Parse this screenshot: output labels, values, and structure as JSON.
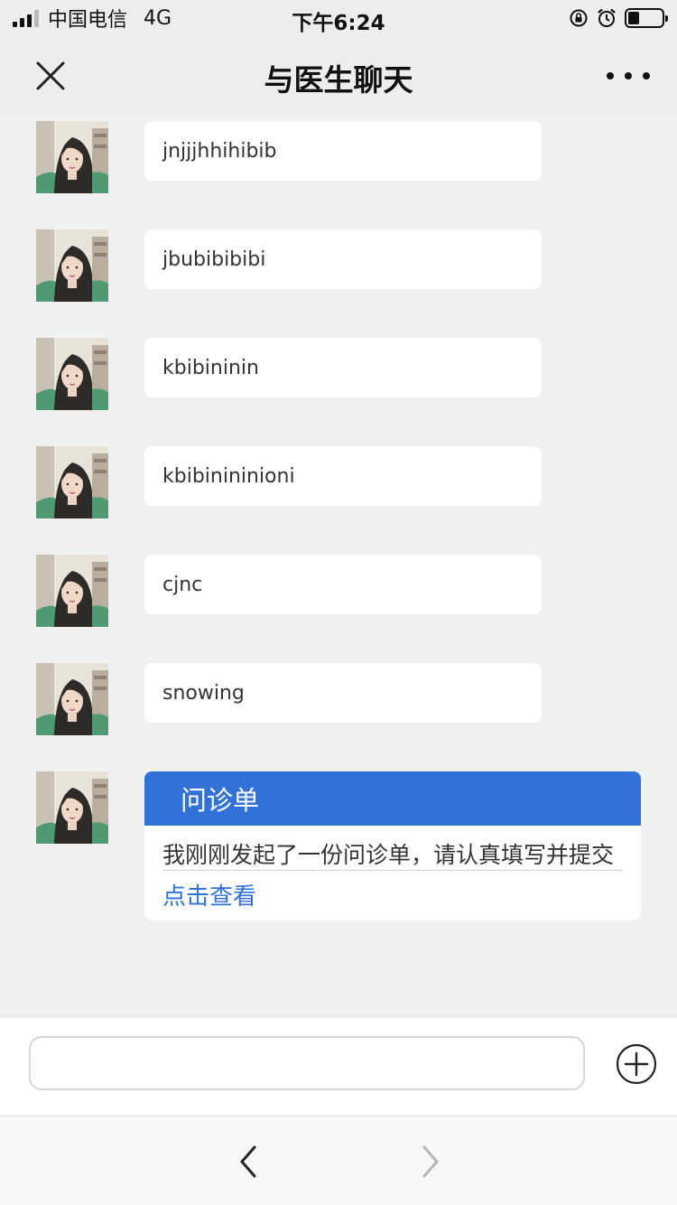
{
  "status_bar": {
    "carrier": "中国电信",
    "network": "4G",
    "time": "下午6:24"
  },
  "nav": {
    "title": "与医生聊天",
    "close_icon": "close-icon",
    "more_icon": "more-icon"
  },
  "messages": [
    {
      "text": "jnjjjhhihibib"
    },
    {
      "text": "jbubibibibi"
    },
    {
      "text": "kbibininin"
    },
    {
      "text": "kbibinininioni"
    },
    {
      "text": "cjnc"
    },
    {
      "text": "snowing"
    }
  ],
  "consultation_card": {
    "title": "问诊单",
    "body": "我刚刚发起了一份问诊单，请认真填写并提交",
    "link": "点击查看"
  },
  "input": {
    "value": "",
    "placeholder": ""
  },
  "colors": {
    "accent": "#3072d8",
    "background": "#f0f0f0"
  }
}
